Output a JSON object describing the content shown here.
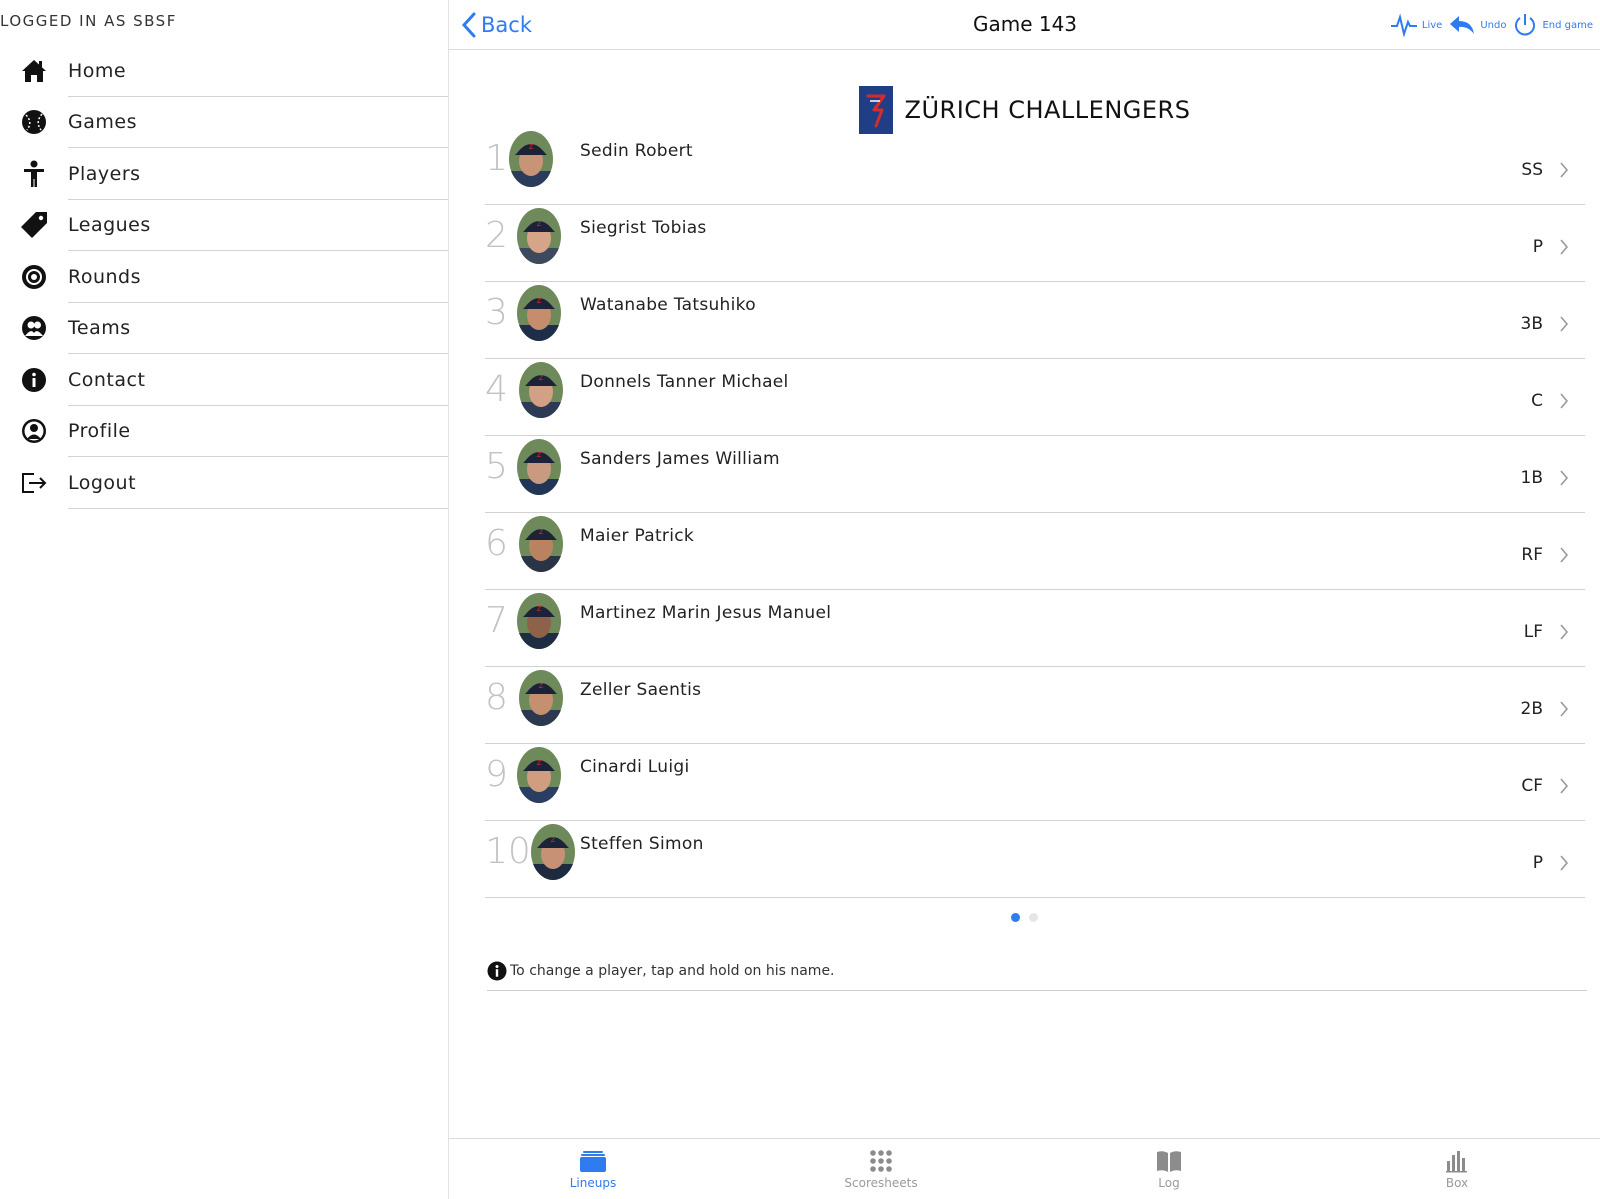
{
  "sidebar": {
    "login_text": "LOGGED IN AS SBSF",
    "items": [
      {
        "label": "Home",
        "icon": "home-icon"
      },
      {
        "label": "Games",
        "icon": "baseball-icon"
      },
      {
        "label": "Players",
        "icon": "person-icon"
      },
      {
        "label": "Leagues",
        "icon": "tag-icon"
      },
      {
        "label": "Rounds",
        "icon": "target-icon"
      },
      {
        "label": "Teams",
        "icon": "team-icon"
      },
      {
        "label": "Contact",
        "icon": "info-icon"
      },
      {
        "label": "Profile",
        "icon": "profile-icon"
      },
      {
        "label": "Logout",
        "icon": "logout-icon"
      }
    ]
  },
  "topbar": {
    "back_label": "Back",
    "title": "Game 143",
    "actions": [
      {
        "label": "Live",
        "icon": "pulse-icon"
      },
      {
        "label": "Undo",
        "icon": "undo-icon"
      },
      {
        "label": "End game",
        "icon": "power-icon"
      }
    ]
  },
  "team": {
    "name": "ZÜRICH CHALLENGERS",
    "logo_letter": "Z"
  },
  "lineup": [
    {
      "order": "1",
      "name": "Sedin Robert",
      "position": "SS"
    },
    {
      "order": "2",
      "name": "Siegrist Tobias",
      "position": "P"
    },
    {
      "order": "3",
      "name": "Watanabe Tatsuhiko",
      "position": "3B"
    },
    {
      "order": "4",
      "name": "Donnels Tanner Michael",
      "position": "C"
    },
    {
      "order": "5",
      "name": "Sanders James William",
      "position": "1B"
    },
    {
      "order": "6",
      "name": "Maier Patrick",
      "position": "RF"
    },
    {
      "order": "7",
      "name": "Martinez Marin Jesus Manuel",
      "position": "LF"
    },
    {
      "order": "8",
      "name": "Zeller Saentis",
      "position": "2B"
    },
    {
      "order": "9",
      "name": "Cinardi Luigi",
      "position": "CF"
    },
    {
      "order": "10",
      "name": "Steffen Simon",
      "position": "P"
    }
  ],
  "pager": {
    "current": 1,
    "total": 2
  },
  "hint": "To change a player, tap and hold on his name.",
  "tabs": [
    {
      "label": "Lineups",
      "icon": "lineups-icon",
      "active": true
    },
    {
      "label": "Scoresheets",
      "icon": "grid-icon",
      "active": false
    },
    {
      "label": "Log",
      "icon": "book-icon",
      "active": false
    },
    {
      "label": "Box",
      "icon": "bar-chart-icon",
      "active": false
    }
  ],
  "colors": {
    "accent": "#2f7bf0",
    "team_blue": "#1f3e85",
    "logo_red": "#d62b2b",
    "muted": "#c2c2c2"
  }
}
